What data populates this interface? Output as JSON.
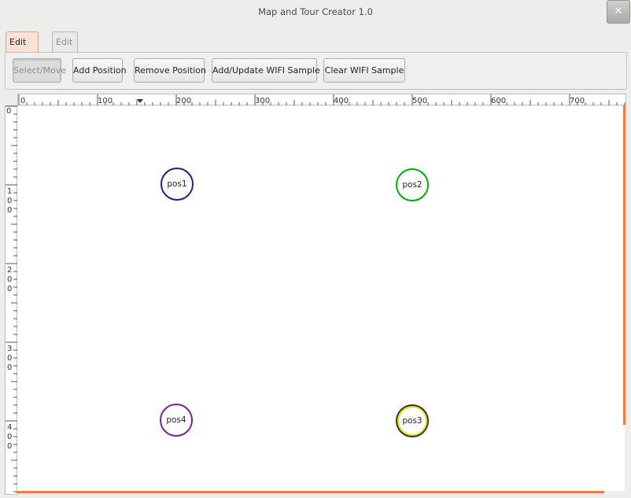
{
  "window": {
    "title": "Map and Tour Creator 1.0",
    "close_symbol": "✕"
  },
  "tabs": [
    {
      "label": "Edit World",
      "active": true
    },
    {
      "label": "Edit Tour",
      "active": false
    }
  ],
  "toolbar": {
    "select_move": "Select/Move",
    "add_position": "Add Position",
    "remove_position": "Remove Position",
    "add_update_wifi": "Add/Update WIFI Sample",
    "clear_wifi": "Clear WIFI Sample"
  },
  "ruler": {
    "horizontal_labels": [
      "0",
      "100",
      "200",
      "300",
      "400",
      "500",
      "600",
      "700"
    ],
    "vertical_labels": [
      "0",
      "100",
      "200",
      "300",
      "400"
    ]
  },
  "positions": [
    {
      "label": "pos1",
      "color": "#1a237e"
    },
    {
      "label": "pos2",
      "color": "#00b000"
    },
    {
      "label": "pos3",
      "color": "#c8c800"
    },
    {
      "label": "pos4",
      "color": "#7a1fa2"
    }
  ],
  "colors": {
    "accent": "#ef7a4a",
    "active_tab": "#fbe2d5"
  }
}
